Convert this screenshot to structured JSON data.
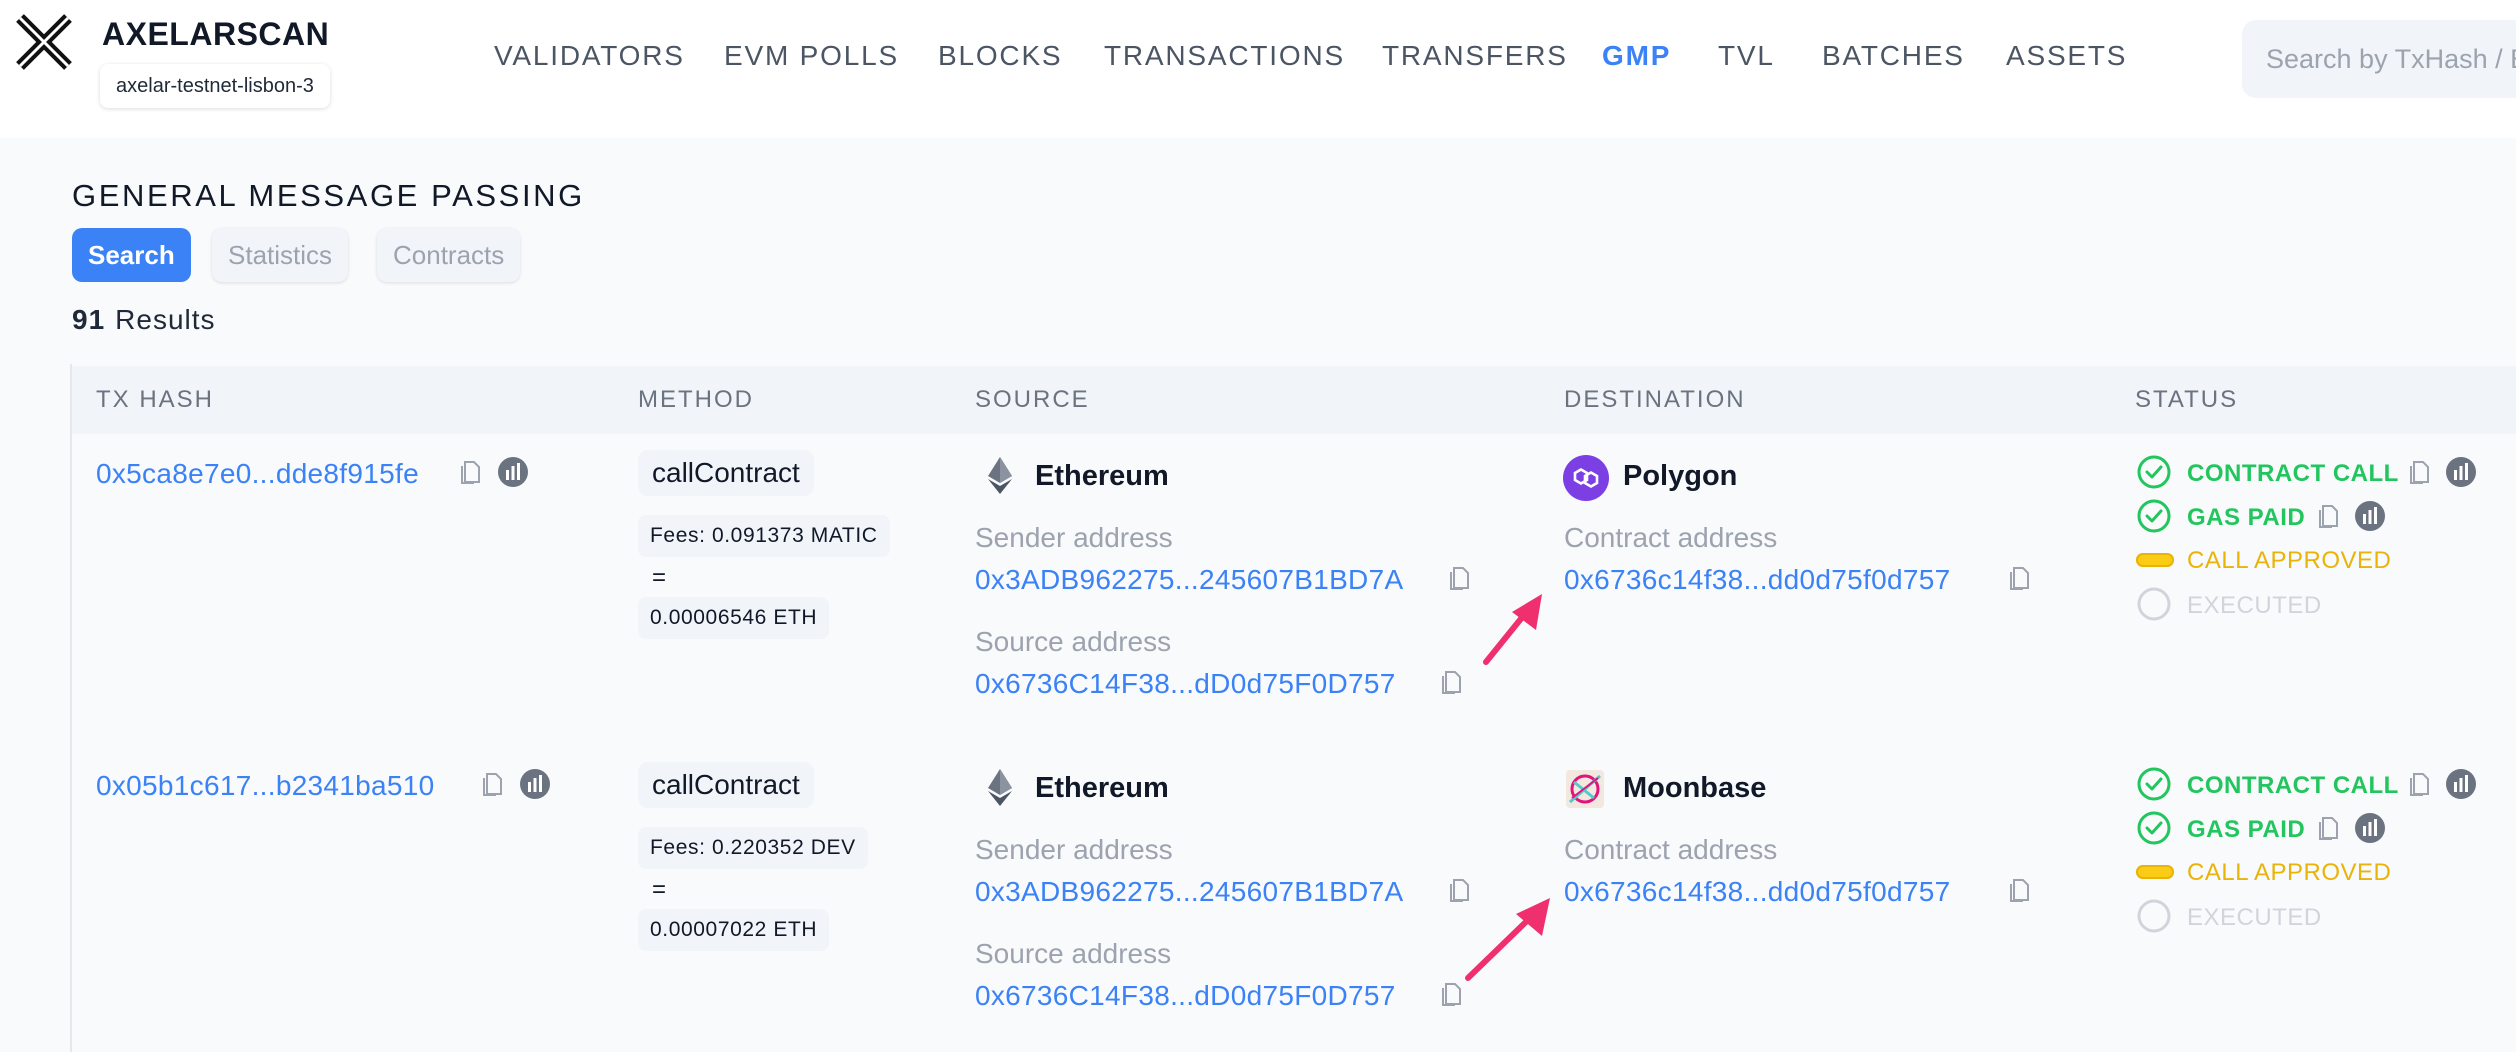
{
  "header": {
    "brand": "AXELARSCAN",
    "network": "axelar-testnet-lisbon-3",
    "nav": [
      "VALIDATORS",
      "EVM POLLS",
      "BLOCKS",
      "TRANSACTIONS",
      "TRANSFERS",
      "GMP",
      "TVL",
      "BATCHES",
      "ASSETS"
    ],
    "active_nav": "GMP",
    "search_placeholder": "Search by TxHash / Block",
    "icons": {
      "logo": "axelar-x-logo"
    }
  },
  "page": {
    "title": "GENERAL MESSAGE PASSING",
    "tabs": [
      {
        "label": "Search",
        "active": true
      },
      {
        "label": "Statistics",
        "active": false
      },
      {
        "label": "Contracts",
        "active": false
      }
    ],
    "results_count": "91",
    "results_label": "Results"
  },
  "table": {
    "columns": [
      "TX HASH",
      "METHOD",
      "SOURCE",
      "DESTINATION",
      "STATUS"
    ],
    "rows": [
      {
        "tx_hash": "0x5ca8e7e0...dde8f915fe",
        "method": "callContract",
        "fees": "Fees: 0.091373 MATIC",
        "fee_eq": "=",
        "fee_converted": "0.00006546 ETH",
        "source_chain": "Ethereum",
        "sender_label": "Sender address",
        "sender_address": "0x3ADB962275...245607B1BD7A",
        "source_label": "Source address",
        "source_address": "0x6736C14F38...dD0d75F0D757",
        "dest_chain": "Polygon",
        "contract_label": "Contract address",
        "contract_address": "0x6736c14f38...dd0d75f0d757",
        "statuses": [
          {
            "label": "CONTRACT CALL",
            "state": "done"
          },
          {
            "label": "GAS PAID",
            "state": "done"
          },
          {
            "label": "CALL APPROVED",
            "state": "pending"
          },
          {
            "label": "EXECUTED",
            "state": "inactive"
          }
        ]
      },
      {
        "tx_hash": "0x05b1c617...b2341ba510",
        "method": "callContract",
        "fees": "Fees: 0.220352 DEV",
        "fee_eq": "=",
        "fee_converted": "0.00007022 ETH",
        "source_chain": "Ethereum",
        "sender_label": "Sender address",
        "sender_address": "0x3ADB962275...245607B1BD7A",
        "source_label": "Source address",
        "source_address": "0x6736C14F38...dD0d75F0D757",
        "dest_chain": "Moonbase",
        "contract_label": "Contract address",
        "contract_address": "0x6736c14f38...dd0d75f0d757",
        "statuses": [
          {
            "label": "CONTRACT CALL",
            "state": "done"
          },
          {
            "label": "GAS PAID",
            "state": "done"
          },
          {
            "label": "CALL APPROVED",
            "state": "pending"
          },
          {
            "label": "EXECUTED",
            "state": "inactive"
          }
        ]
      }
    ]
  },
  "colors": {
    "accent": "#3b82f6",
    "success": "#22c55e",
    "pending": "#eab308",
    "inactive": "#d1d5db",
    "annotation_arrow": "#f0306e"
  }
}
